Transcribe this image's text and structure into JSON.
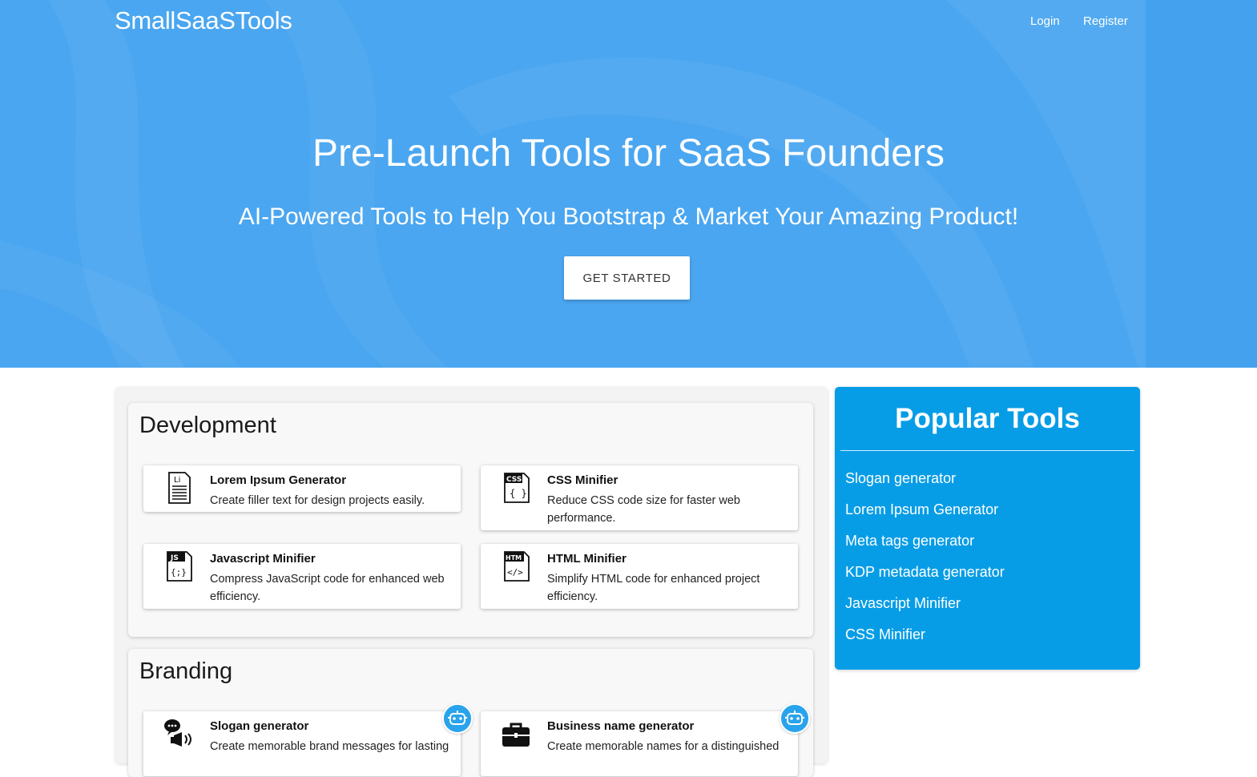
{
  "header": {
    "brand": "SmallSaaSTools",
    "nav": [
      {
        "label": "Login"
      },
      {
        "label": "Register"
      }
    ]
  },
  "hero": {
    "title": "Pre-Launch Tools for SaaS Founders",
    "subtitle": "AI-Powered Tools to Help You Bootstrap & Market Your Amazing Product!",
    "cta_label": "GET STARTED"
  },
  "sections": [
    {
      "title": "Development",
      "tools": [
        {
          "name": "Lorem Ipsum Generator",
          "desc": "Create filler text for design projects easily.",
          "icon": "lorem-ipsum-file-icon",
          "icon_text": "Li"
        },
        {
          "name": "CSS Minifier",
          "desc": "Reduce CSS code size for faster web performance.",
          "icon": "css-file-icon",
          "icon_text": "CSS"
        },
        {
          "name": "Javascript Minifier",
          "desc": "Compress JavaScript code for enhanced web efficiency.",
          "icon": "js-file-icon",
          "icon_text": "JS"
        },
        {
          "name": "HTML Minifier",
          "desc": "Simplify HTML code for enhanced project efficiency.",
          "icon": "html-file-icon",
          "icon_text": "HTM"
        }
      ]
    },
    {
      "title": "Branding",
      "tools": [
        {
          "name": "Slogan generator",
          "desc": "Create memorable brand messages for lasting",
          "icon": "megaphone-icon",
          "ai": true
        },
        {
          "name": "Business name generator",
          "desc": "Create memorable names for a distinguished",
          "icon": "briefcase-icon",
          "ai": true
        }
      ]
    }
  ],
  "sidebar": {
    "title": "Popular Tools",
    "items": [
      {
        "label": "Slogan generator"
      },
      {
        "label": "Lorem Ipsum Generator"
      },
      {
        "label": "Meta tags generator"
      },
      {
        "label": "KDP metadata generator"
      },
      {
        "label": "Javascript Minifier"
      },
      {
        "label": "CSS Minifier"
      }
    ]
  },
  "colors": {
    "hero_bg": "#4aa6f0",
    "sidebar_bg": "#079de6",
    "ai_badge": "#29a3ec"
  }
}
